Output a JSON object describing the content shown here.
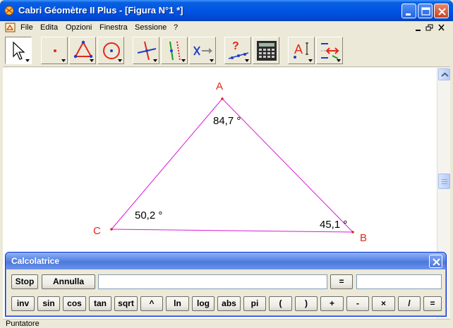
{
  "window": {
    "title": "Cabri Géomètre II Plus - [Figura N°1 *]"
  },
  "menu": {
    "items": [
      "File",
      "Edita",
      "Opzioni",
      "Finestra",
      "Sessione",
      "?"
    ]
  },
  "toolbar": {
    "tools": [
      {
        "name": "pointer-tool-icon"
      },
      {
        "name": "point-tool-icon"
      },
      {
        "name": "triangle-tool-icon"
      },
      {
        "name": "circle-tool-icon"
      },
      {
        "name": "construct-tool-icon"
      },
      {
        "name": "transform-tool-icon"
      },
      {
        "name": "macro-tool-icon"
      },
      {
        "name": "check-property-tool-icon"
      },
      {
        "name": "calculator-tool-icon"
      },
      {
        "name": "label-tool-icon"
      },
      {
        "name": "attribute-tool-icon"
      }
    ]
  },
  "figure": {
    "vertices": {
      "A": "A",
      "B": "B",
      "C": "C"
    },
    "angles": {
      "A": "84,7 °",
      "B": "45,1 °",
      "C": "50,2 °"
    },
    "colors": {
      "segment": "#d81ad8",
      "point": "#e3281c",
      "label": "#e3281c"
    }
  },
  "calculator": {
    "title": "Calcolatrice",
    "stop_label": "Stop",
    "cancel_label": "Annulla",
    "equals_label": "=",
    "expression_value": "",
    "result_value": "",
    "functions": [
      "inv",
      "sin",
      "cos",
      "tan",
      "sqrt",
      "^",
      "ln",
      "log",
      "abs",
      "pi",
      "(",
      ")",
      "+",
      "-",
      "×",
      "/",
      "="
    ]
  },
  "status": {
    "text": "Puntatore"
  }
}
